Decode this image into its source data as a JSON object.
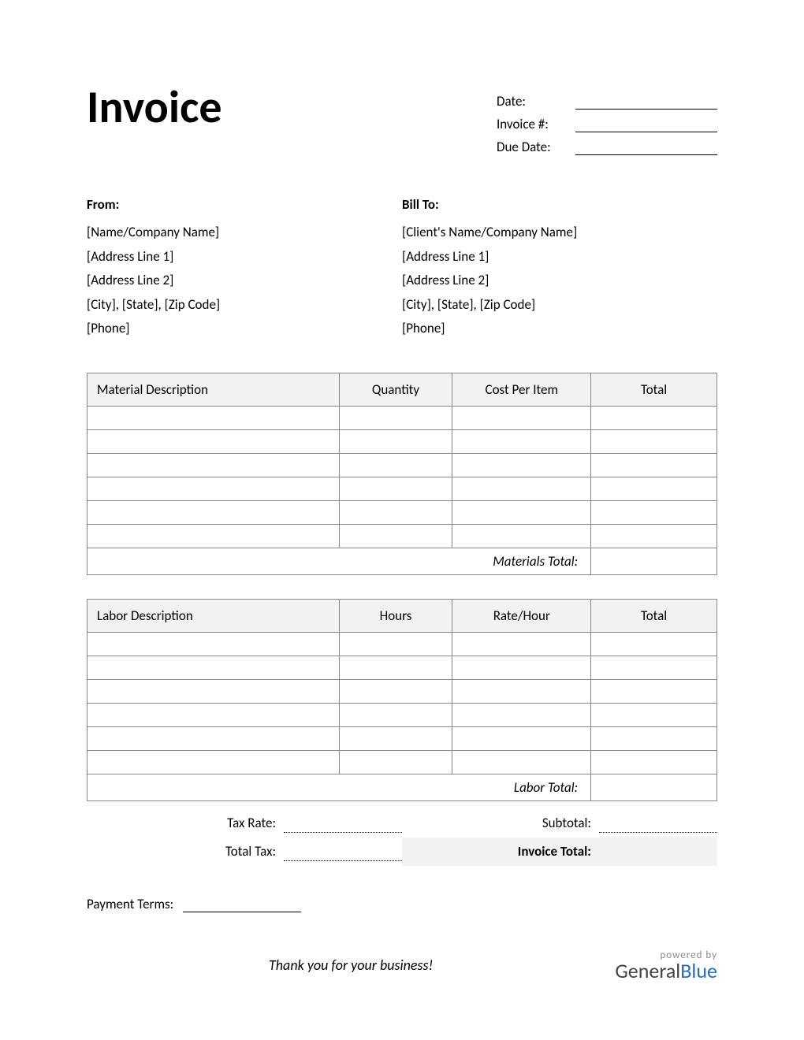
{
  "title": "Invoice",
  "meta": {
    "date_label": "Date:",
    "invoice_no_label": "Invoice #:",
    "due_date_label": "Due Date:"
  },
  "from": {
    "heading": "From:",
    "name": "[Name/Company Name]",
    "addr1": "[Address Line 1]",
    "addr2": "[Address Line 2]",
    "city": "[City], [State], [Zip Code]",
    "phone": "[Phone]"
  },
  "bill_to": {
    "heading": "Bill To:",
    "name": "[Client's Name/Company Name]",
    "addr1": "[Address Line 1]",
    "addr2": "[Address Line 2]",
    "city": "[City], [State], [Zip Code]",
    "phone": "[Phone]"
  },
  "materials_table": {
    "headers": {
      "desc": "Material Description",
      "qty": "Quantity",
      "cost": "Cost Per Item",
      "total": "Total"
    },
    "section_total_label": "Materials Total:"
  },
  "labor_table": {
    "headers": {
      "desc": "Labor Description",
      "qty": "Hours",
      "cost": "Rate/Hour",
      "total": "Total"
    },
    "section_total_label": "Labor Total:"
  },
  "summary": {
    "tax_rate_label": "Tax Rate:",
    "total_tax_label": "Total Tax:",
    "subtotal_label": "Subtotal:",
    "invoice_total_label": "Invoice Total:"
  },
  "payment_terms_label": "Payment Terms:",
  "thank_you": "Thank you for your business!",
  "branding": {
    "powered_by": "powered by",
    "name1": "General",
    "name2": "Blue"
  }
}
